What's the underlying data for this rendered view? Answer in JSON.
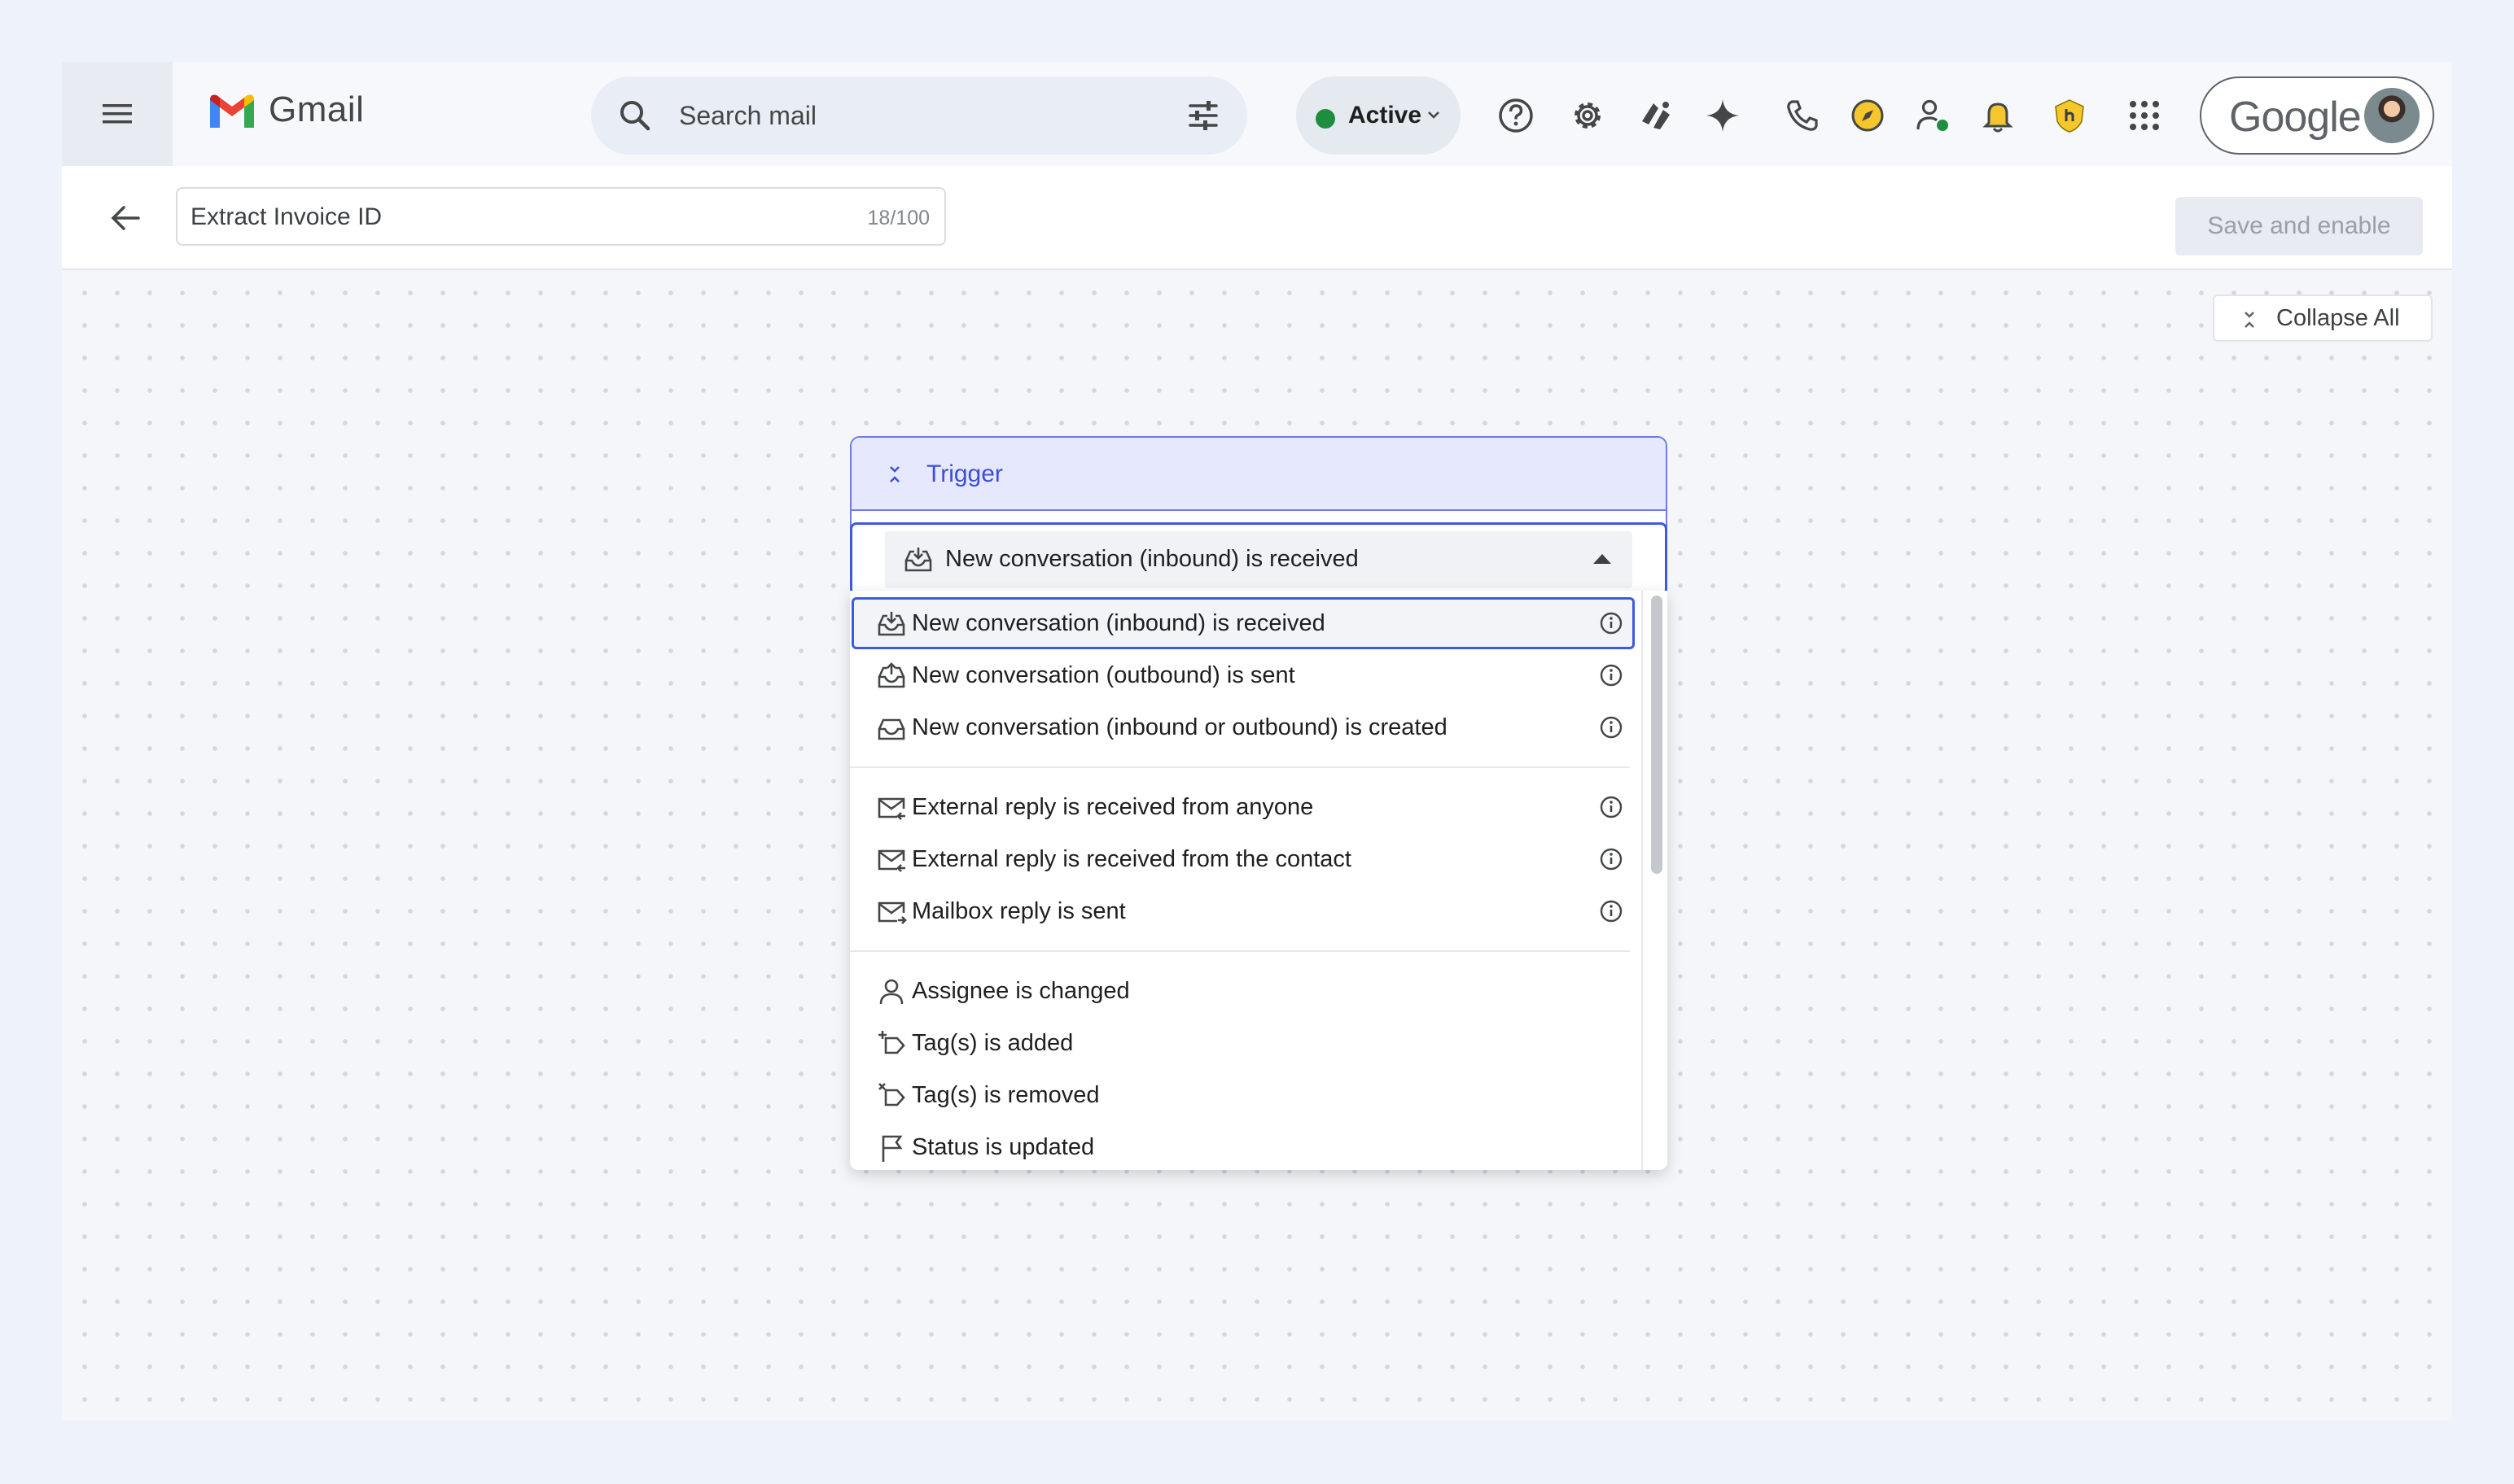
{
  "topbar": {
    "menu_icon": "hamburger-menu-icon",
    "app_name": "Gmail",
    "search": {
      "placeholder": "Search mail"
    },
    "status": {
      "label": "Active",
      "color": "#1e8e3e"
    },
    "icons": [
      "help-icon",
      "settings-icon",
      "extension-icon",
      "gemini-sparkle-icon",
      "phone-icon",
      "compass-icon",
      "contact-status-icon",
      "bell-icon",
      "shield-extension-icon",
      "apps-grid-icon"
    ],
    "account_label": "Google"
  },
  "subbar": {
    "workflow_name": "Extract Invoice ID",
    "char_count": "18/100",
    "save_label": "Save and enable"
  },
  "canvas": {
    "collapse_all_label": "Collapse All",
    "trigger": {
      "title": "Trigger",
      "selected_value": "New conversation (inbound) is received",
      "options": [
        {
          "label": "New conversation (inbound) is received",
          "icon": "inbox-in-icon",
          "info": true,
          "selected": true
        },
        {
          "label": "New conversation (outbound) is sent",
          "icon": "inbox-out-icon",
          "info": true
        },
        {
          "label": "New conversation (inbound or outbound) is created",
          "icon": "inbox-icon",
          "info": true
        },
        {
          "label": "External reply is received from anyone",
          "icon": "mail-reply-in-icon",
          "info": true
        },
        {
          "label": "External reply is received from the contact",
          "icon": "mail-reply-in-icon",
          "info": true
        },
        {
          "label": "Mailbox reply is sent",
          "icon": "mail-reply-out-icon",
          "info": true
        },
        {
          "label": "Assignee is changed",
          "icon": "person-icon",
          "info": false
        },
        {
          "label": "Tag(s) is added",
          "icon": "tag-add-icon",
          "info": false
        },
        {
          "label": "Tag(s) is removed",
          "icon": "tag-remove-icon",
          "info": false
        },
        {
          "label": "Status is updated",
          "icon": "flag-icon",
          "info": false
        }
      ]
    }
  },
  "colors": {
    "accent": "#3d5be0",
    "trigger_header_bg": "#e6e8fd",
    "trigger_text": "#3d4fd8"
  }
}
